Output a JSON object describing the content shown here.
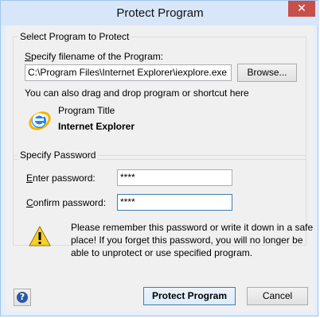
{
  "window": {
    "title": "Protect Program",
    "close_glyph": "✕"
  },
  "program_group": {
    "legend": "Select Program to Protect",
    "filename_label_accesskey": "S",
    "filename_label_rest": "pecify filename of the Program:",
    "filename_value": "C:\\Program Files\\Internet Explorer\\iexplore.exe",
    "browse_label": "Browse...",
    "drag_hint": "You can also drag and drop program or shortcut here",
    "program_title_label": "Program Title",
    "program_title_value": "Internet Explorer",
    "program_icon": "internet-explorer-icon"
  },
  "password_group": {
    "legend": "Specify Password",
    "enter_label_accesskey": "E",
    "enter_label_rest": "nter password:",
    "enter_value": "****",
    "confirm_label_accesskey": "C",
    "confirm_label_rest": "onfirm password:",
    "confirm_value": "****"
  },
  "warning": {
    "icon": "warning-icon",
    "text_line1": "Please remember this password or write it down in a safe",
    "text_line2": "place! If you forget this password, you will no longer be",
    "text_line3": "able to unprotect or use specified program."
  },
  "footer": {
    "help_glyph": "?",
    "protect_label": "Protect Program",
    "cancel_label": "Cancel"
  },
  "colors": {
    "window_border": "#a0c4ec",
    "close_button": "#c7504b",
    "default_button_border": "#3c7fb1"
  }
}
